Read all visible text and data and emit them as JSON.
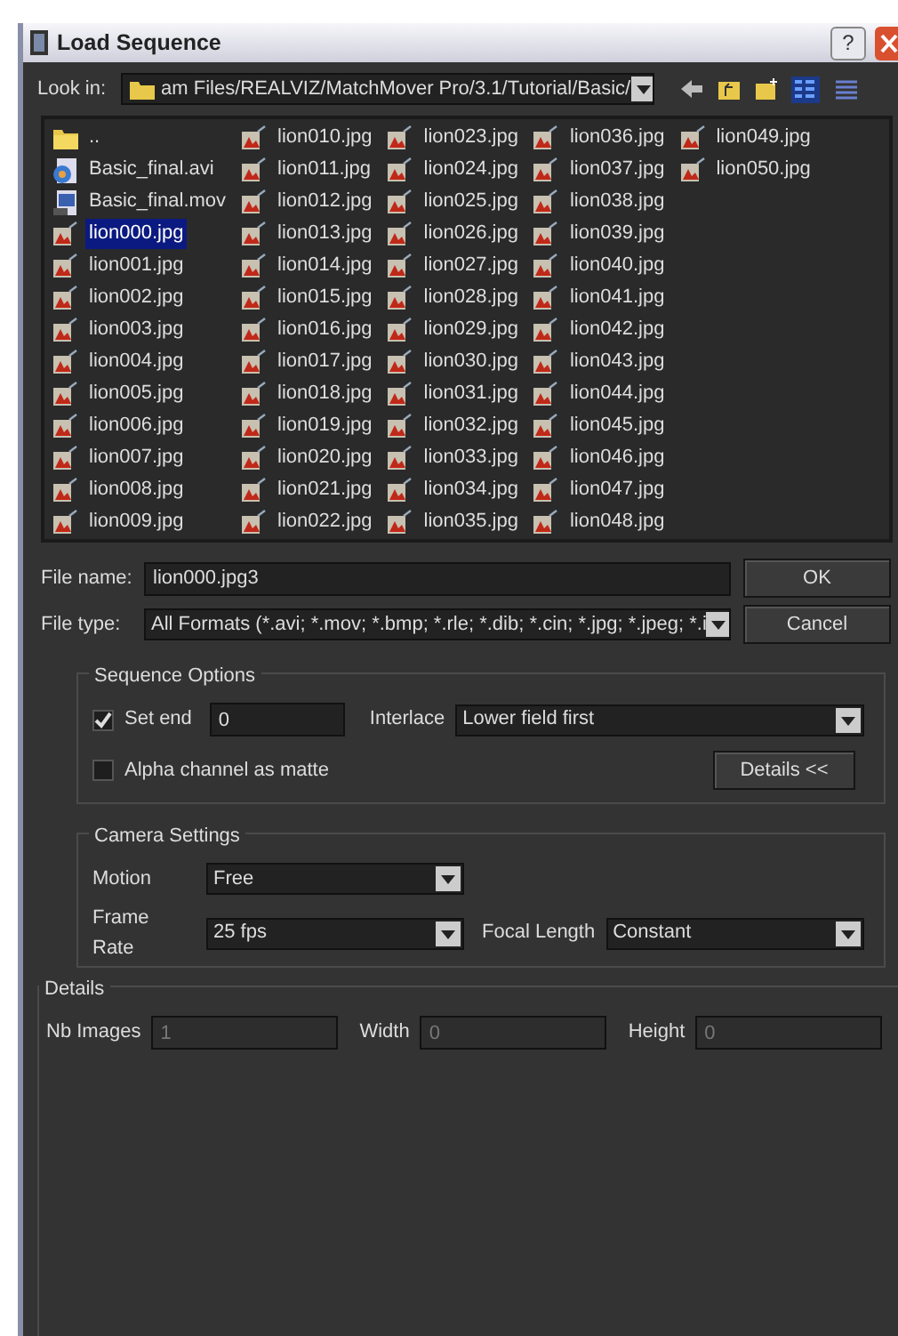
{
  "window": {
    "title": "Load Sequence",
    "help": "?"
  },
  "look_in": {
    "label": "Look in:",
    "path": "am Files/REALVIZ/MatchMover Pro/3.1/Tutorial/Basic/"
  },
  "view_buttons": [
    {
      "kind": "list",
      "selected": true
    },
    {
      "kind": "details",
      "selected": false
    }
  ],
  "files": [
    {
      "name": "..",
      "kind": "folder",
      "selected": false
    },
    {
      "name": "Basic_final.avi",
      "kind": "video",
      "selected": false
    },
    {
      "name": "Basic_final.mov",
      "kind": "movie",
      "selected": false
    },
    {
      "name": "lion000.jpg",
      "kind": "image",
      "selected": true
    },
    {
      "name": "lion001.jpg",
      "kind": "image",
      "selected": false
    },
    {
      "name": "lion002.jpg",
      "kind": "image",
      "selected": false
    },
    {
      "name": "lion003.jpg",
      "kind": "image",
      "selected": false
    },
    {
      "name": "lion004.jpg",
      "kind": "image",
      "selected": false
    },
    {
      "name": "lion005.jpg",
      "kind": "image",
      "selected": false
    },
    {
      "name": "lion006.jpg",
      "kind": "image",
      "selected": false
    },
    {
      "name": "lion007.jpg",
      "kind": "image",
      "selected": false
    },
    {
      "name": "lion008.jpg",
      "kind": "image",
      "selected": false
    },
    {
      "name": "lion009.jpg",
      "kind": "image",
      "selected": false
    },
    {
      "name": "lion010.jpg",
      "kind": "image",
      "selected": false
    },
    {
      "name": "lion011.jpg",
      "kind": "image",
      "selected": false
    },
    {
      "name": "lion012.jpg",
      "kind": "image",
      "selected": false
    },
    {
      "name": "lion013.jpg",
      "kind": "image",
      "selected": false
    },
    {
      "name": "lion014.jpg",
      "kind": "image",
      "selected": false
    },
    {
      "name": "lion015.jpg",
      "kind": "image",
      "selected": false
    },
    {
      "name": "lion016.jpg",
      "kind": "image",
      "selected": false
    },
    {
      "name": "lion017.jpg",
      "kind": "image",
      "selected": false
    },
    {
      "name": "lion018.jpg",
      "kind": "image",
      "selected": false
    },
    {
      "name": "lion019.jpg",
      "kind": "image",
      "selected": false
    },
    {
      "name": "lion020.jpg",
      "kind": "image",
      "selected": false
    },
    {
      "name": "lion021.jpg",
      "kind": "image",
      "selected": false
    },
    {
      "name": "lion022.jpg",
      "kind": "image",
      "selected": false
    },
    {
      "name": "lion023.jpg",
      "kind": "image",
      "selected": false
    },
    {
      "name": "lion024.jpg",
      "kind": "image",
      "selected": false
    },
    {
      "name": "lion025.jpg",
      "kind": "image",
      "selected": false
    },
    {
      "name": "lion026.jpg",
      "kind": "image",
      "selected": false
    },
    {
      "name": "lion027.jpg",
      "kind": "image",
      "selected": false
    },
    {
      "name": "lion028.jpg",
      "kind": "image",
      "selected": false
    },
    {
      "name": "lion029.jpg",
      "kind": "image",
      "selected": false
    },
    {
      "name": "lion030.jpg",
      "kind": "image",
      "selected": false
    },
    {
      "name": "lion031.jpg",
      "kind": "image",
      "selected": false
    },
    {
      "name": "lion032.jpg",
      "kind": "image",
      "selected": false
    },
    {
      "name": "lion033.jpg",
      "kind": "image",
      "selected": false
    },
    {
      "name": "lion034.jpg",
      "kind": "image",
      "selected": false
    },
    {
      "name": "lion035.jpg",
      "kind": "image",
      "selected": false
    },
    {
      "name": "lion036.jpg",
      "kind": "image",
      "selected": false
    },
    {
      "name": "lion037.jpg",
      "kind": "image",
      "selected": false
    },
    {
      "name": "lion038.jpg",
      "kind": "image",
      "selected": false
    },
    {
      "name": "lion039.jpg",
      "kind": "image",
      "selected": false
    },
    {
      "name": "lion040.jpg",
      "kind": "image",
      "selected": false
    },
    {
      "name": "lion041.jpg",
      "kind": "image",
      "selected": false
    },
    {
      "name": "lion042.jpg",
      "kind": "image",
      "selected": false
    },
    {
      "name": "lion043.jpg",
      "kind": "image",
      "selected": false
    },
    {
      "name": "lion044.jpg",
      "kind": "image",
      "selected": false
    },
    {
      "name": "lion045.jpg",
      "kind": "image",
      "selected": false
    },
    {
      "name": "lion046.jpg",
      "kind": "image",
      "selected": false
    },
    {
      "name": "lion047.jpg",
      "kind": "image",
      "selected": false
    },
    {
      "name": "lion048.jpg",
      "kind": "image",
      "selected": false
    },
    {
      "name": "lion049.jpg",
      "kind": "image",
      "selected": false
    },
    {
      "name": "lion050.jpg",
      "kind": "image",
      "selected": false
    }
  ],
  "file_name": {
    "label": "File name:",
    "value": "lion000.jpg3"
  },
  "file_type": {
    "label": "File type:",
    "value": "All Formats (*.avi; *.mov; *.bmp; *.rle; *.dib; *.cin; *.jpg; *.jpeg; *.i"
  },
  "buttons": [
    "OK",
    "Cancel"
  ],
  "sequence_options": {
    "title": "Sequence Options",
    "set_end": {
      "label": "Set end",
      "checked": true,
      "value": "0"
    },
    "interlace": {
      "label": "Interlace",
      "value": "Lower field first"
    },
    "alpha": {
      "label": "Alpha channel as matte",
      "checked": false
    },
    "details_button": "Details <<"
  },
  "camera_settings": {
    "title": "Camera Settings",
    "motion": {
      "label": "Motion",
      "value": "Free"
    },
    "frame_rate": {
      "label": "Frame Rate",
      "value": "25 fps"
    },
    "focal_length": {
      "label": "Focal Length",
      "value": "Constant"
    }
  },
  "details": {
    "title": "Details",
    "fields": [
      {
        "label": "Nb Images",
        "value": "1"
      },
      {
        "label": "Width",
        "value": "0"
      },
      {
        "label": "Height",
        "value": "0"
      }
    ]
  }
}
